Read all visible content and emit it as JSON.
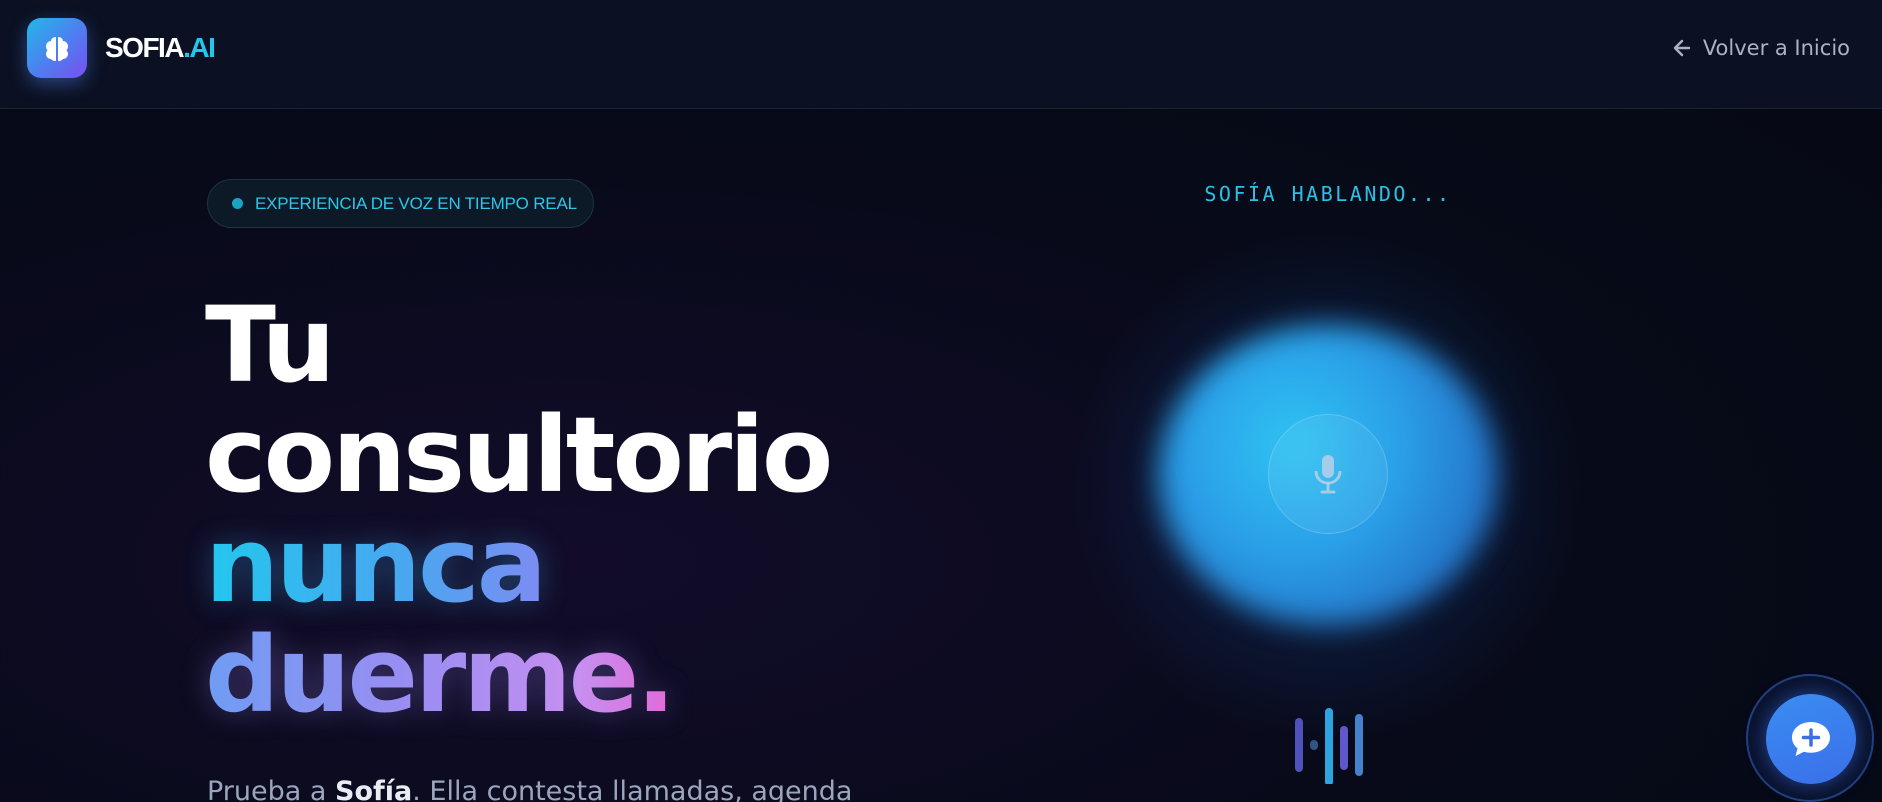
{
  "header": {
    "brand_main": "SOFIA",
    "brand_accent": ".AI",
    "logo_icon": "brain-icon",
    "back_icon": "arrow-left-icon",
    "back_label": "Volver a Inicio"
  },
  "hero": {
    "badge_text": "EXPERIENCIA DE VOZ EN TIEMPO REAL",
    "headline": {
      "line1": "Tu",
      "line2": "consultorio",
      "line3": "nunca",
      "line4": "duerme."
    },
    "subtext_prefix": "Prueba a ",
    "subtext_name": "Sofía",
    "subtext_rest": ". Ella contesta llamadas, agenda"
  },
  "voice": {
    "status_label": "SOFÍA HABLANDO...",
    "mic_icon": "microphone-icon",
    "wave_icon": "audio-wave-icon"
  },
  "fab": {
    "icon": "chat-plus-icon"
  },
  "colors": {
    "accent_cyan": "#22c7ee",
    "accent_purple": "#9b8df2",
    "background": "#070a18",
    "fab_blue": "#3b6fe8"
  }
}
